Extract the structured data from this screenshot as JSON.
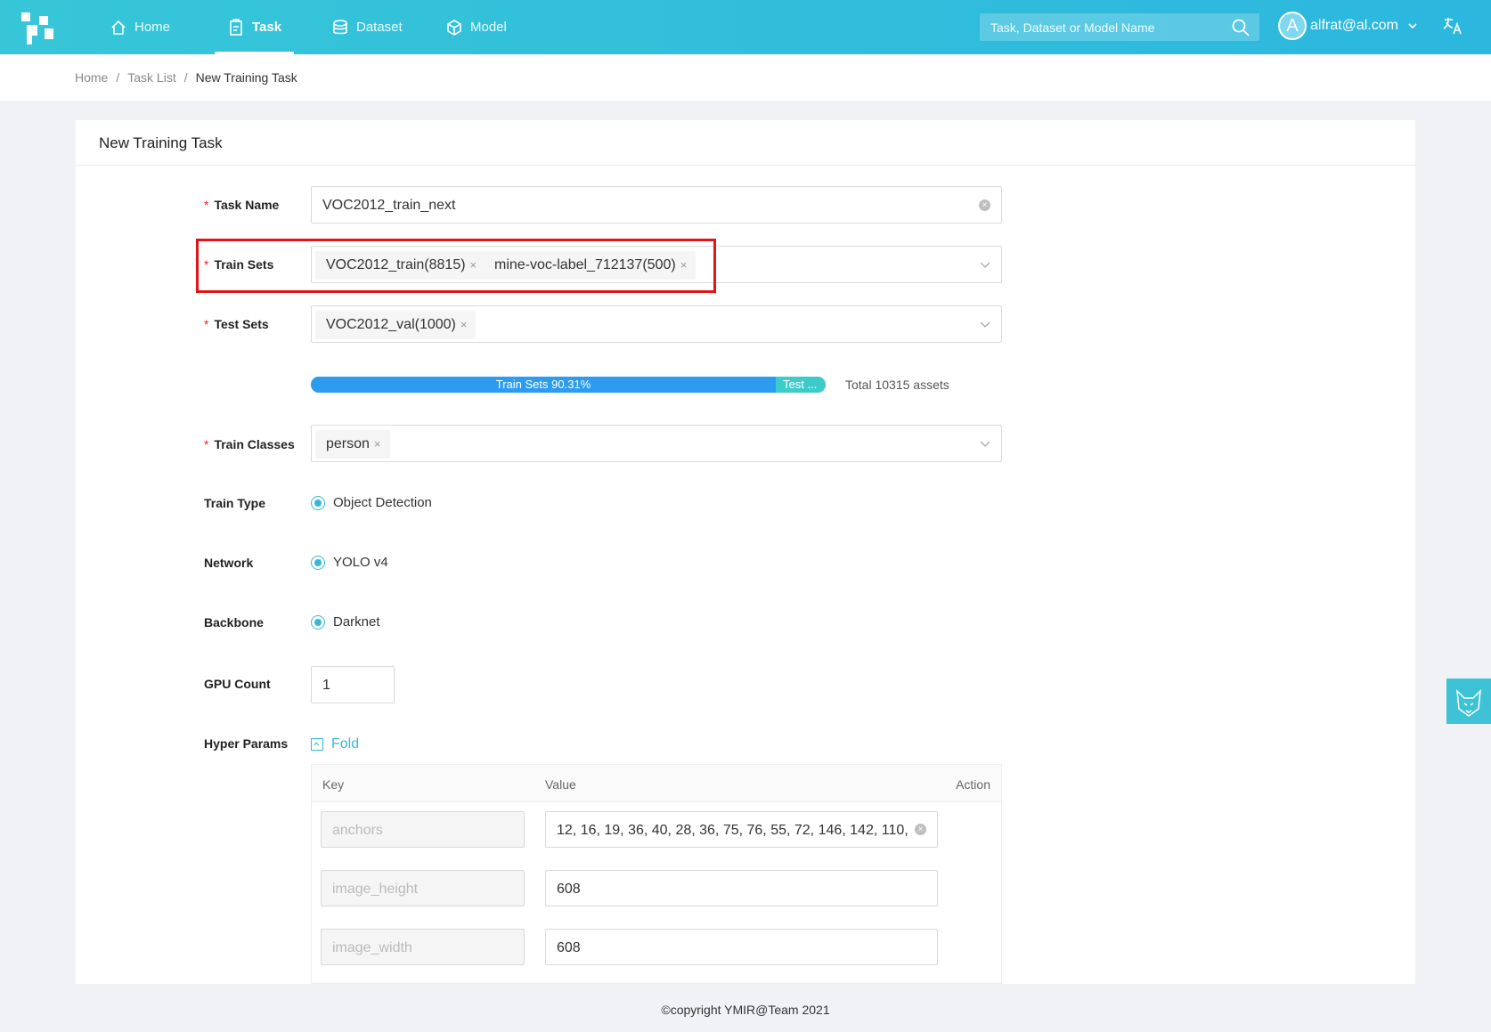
{
  "nav": {
    "items": [
      {
        "label": "Home",
        "icon": "home-icon"
      },
      {
        "label": "Task",
        "icon": "task-icon",
        "active": true
      },
      {
        "label": "Dataset",
        "icon": "dataset-icon"
      },
      {
        "label": "Model",
        "icon": "model-icon"
      }
    ],
    "search_placeholder": "Task, Dataset or Model Name",
    "avatar_letter": "A",
    "user_email": "alfrat@al.com"
  },
  "breadcrumb": {
    "items": [
      "Home",
      "Task List",
      "New Training Task"
    ],
    "separator": "/"
  },
  "form": {
    "title": "New Training Task",
    "task_name": {
      "label": "Task Name",
      "value": "VOC2012_train_next"
    },
    "train_sets": {
      "label": "Train Sets",
      "tags": [
        "VOC2012_train(8815)",
        "mine-voc-label_712137(500)"
      ]
    },
    "test_sets": {
      "label": "Test Sets",
      "tags": [
        "VOC2012_val(1000)"
      ]
    },
    "ratio": {
      "train_label": "Train Sets 90.31%",
      "train_fraction": 0.9031,
      "test_label": "Test ...",
      "total": "Total 10315 assets"
    },
    "train_classes": {
      "label": "Train Classes",
      "tags": [
        "person"
      ]
    },
    "train_type": {
      "label": "Train Type",
      "value": "Object Detection"
    },
    "network": {
      "label": "Network",
      "value": "YOLO v4"
    },
    "backbone": {
      "label": "Backbone",
      "value": "Darknet"
    },
    "gpu_count": {
      "label": "GPU Count",
      "value": "1"
    },
    "hyper_params": {
      "label": "Hyper Params",
      "fold_label": "Fold",
      "columns": [
        "Key",
        "Value",
        "Action"
      ],
      "rows": [
        {
          "key": "anchors",
          "value": "12, 16, 19, 36, 40, 28, 36, 75, 76, 55, 72, 146, 142, 110,"
        },
        {
          "key": "image_height",
          "value": "608"
        },
        {
          "key": "image_width",
          "value": "608"
        }
      ]
    }
  },
  "footer": "©copyright YMIR@Team 2021",
  "colors": {
    "accent": "#36b9d8",
    "train_bar": "#2d9cf0",
    "test_bar": "#3dcbc9",
    "required": "#f5222d",
    "highlight": "#e0151b"
  }
}
